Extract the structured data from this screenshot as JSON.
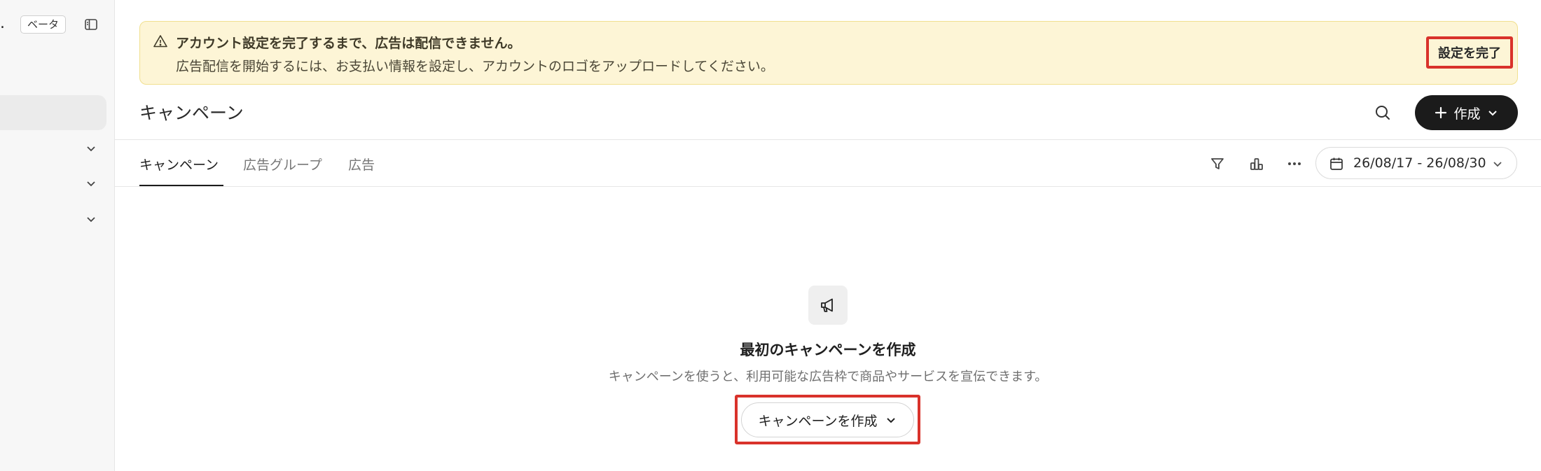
{
  "sidebar": {
    "dot": ".",
    "beta_badge": "ベータ",
    "icons": [
      "sidebar-toggle-icon",
      "chevron-down-icon"
    ]
  },
  "banner": {
    "title": "アカウント設定を完了するまで、広告は配信できません。",
    "text": "広告配信を開始するには、お支払い情報を設定し、アカウントのロゴをアップロードしてください。",
    "button": "設定を完了",
    "icon": "warning-icon",
    "background": "#fdf5d6",
    "highlight_color": "#d9322b"
  },
  "header": {
    "title": "キャンペーン",
    "create_button": "作成",
    "icons": [
      "search-icon",
      "plus-icon",
      "chevron-down-icon"
    ]
  },
  "tabs": [
    {
      "label": "キャンペーン",
      "active": true
    },
    {
      "label": "広告グループ",
      "active": false
    },
    {
      "label": "広告",
      "active": false
    }
  ],
  "toolbar": {
    "icons": [
      "filter-icon",
      "chart-icon",
      "more-icon"
    ],
    "date_range": "26/08/17 - 26/08/30"
  },
  "empty_state": {
    "icon": "megaphone-icon",
    "title": "最初のキャンペーンを作成",
    "description": "キャンペーンを使うと、利用可能な広告枠で商品やサービスを宣伝できます。",
    "button": "キャンペーンを作成"
  }
}
